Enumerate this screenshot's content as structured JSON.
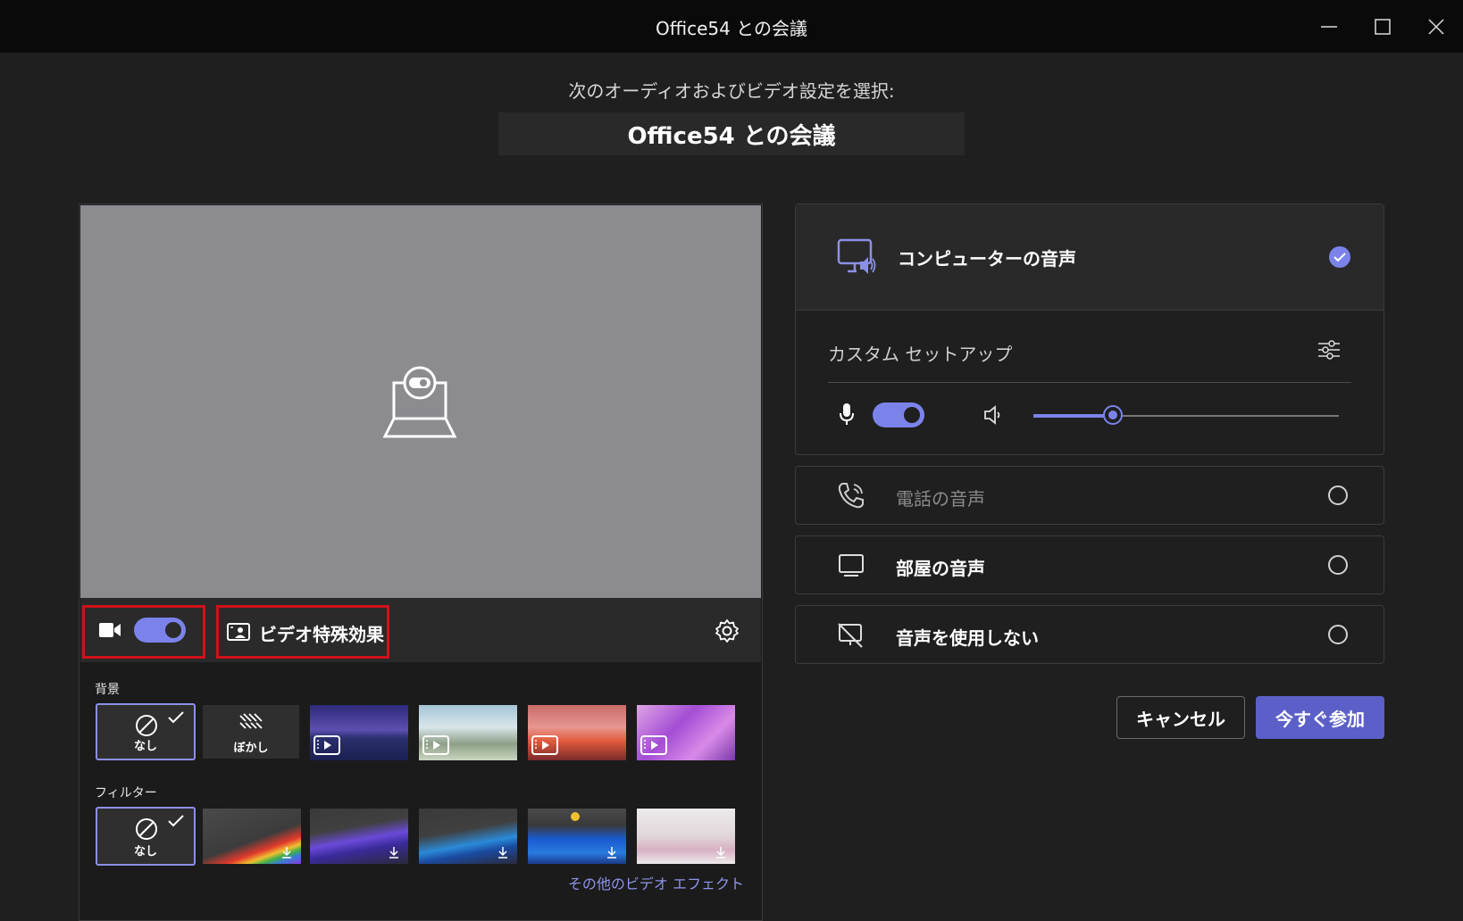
{
  "window": {
    "title": "Office54 との会議"
  },
  "header": {
    "subtitle": "次のオーディオおよびビデオ設定を選択:",
    "meeting_name": "Office54 との会議"
  },
  "video": {
    "camera_on": true,
    "effects_label": "ビデオ特殊効果",
    "background_label": "背景",
    "background_tiles": [
      {
        "label": "なし",
        "selected": true,
        "kind": "none"
      },
      {
        "label": "ぼかし",
        "selected": false,
        "kind": "blur"
      },
      {
        "label": "",
        "kind": "video",
        "theme": "purple-mountains"
      },
      {
        "label": "",
        "kind": "video",
        "theme": "snowy-trees"
      },
      {
        "label": "",
        "kind": "video",
        "theme": "pink-clouds"
      },
      {
        "label": "",
        "kind": "video",
        "theme": "purple-flowers"
      }
    ],
    "filter_label": "フィルター",
    "filter_tiles": [
      {
        "label": "なし",
        "selected": true,
        "kind": "none"
      },
      {
        "kind": "download",
        "theme": "rainbow"
      },
      {
        "kind": "download",
        "theme": "purple-wave"
      },
      {
        "kind": "download",
        "theme": "blue-wave"
      },
      {
        "kind": "download",
        "theme": "blue-whale"
      },
      {
        "kind": "download",
        "theme": "pink-smoke"
      }
    ],
    "more_effects_link": "その他のビデオ エフェクト"
  },
  "audio": {
    "computer_audio": {
      "label": "コンピューターの音声",
      "selected": true
    },
    "custom_setup_label": "カスタム セットアップ",
    "mic_on": true,
    "speaker_volume": 0.26,
    "options": [
      {
        "label": "電話の音声",
        "disabled": true,
        "selected": false
      },
      {
        "label": "部屋の音声",
        "disabled": false,
        "selected": false
      },
      {
        "label": "音声を使用しない",
        "disabled": false,
        "selected": false
      }
    ]
  },
  "actions": {
    "cancel_label": "キャンセル",
    "join_label": "今すぐ参加"
  },
  "colors": {
    "accent": "#7b83eb",
    "join_button": "#5b5fc7",
    "highlight_box": "#d1111b"
  }
}
